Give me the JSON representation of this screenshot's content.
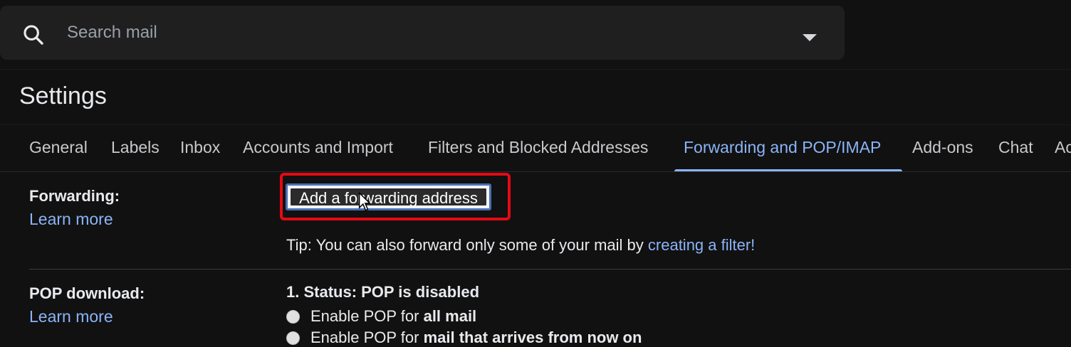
{
  "search": {
    "placeholder": "Search mail"
  },
  "page_title": "Settings",
  "tabs": [
    {
      "label": "General",
      "active": false
    },
    {
      "label": "Labels",
      "active": false
    },
    {
      "label": "Inbox",
      "active": false
    },
    {
      "label": "Accounts and Import",
      "active": false
    },
    {
      "label": "Filters and Blocked Addresses",
      "active": false
    },
    {
      "label": "Forwarding and POP/IMAP",
      "active": true
    },
    {
      "label": "Add-ons",
      "active": false
    },
    {
      "label": "Chat",
      "active": false
    },
    {
      "label": "Ac",
      "active": false
    }
  ],
  "forwarding": {
    "label": "Forwarding:",
    "learn_more": "Learn more",
    "button_label": "Add a forwarding address",
    "tip_prefix": "Tip: You can also forward only some of your mail by ",
    "tip_link": "creating a filter!"
  },
  "pop": {
    "label": "POP download:",
    "learn_more": "Learn more",
    "status": "1. Status: POP is disabled",
    "option1_prefix": "Enable POP for ",
    "option1_bold": "all mail",
    "option2_prefix": "Enable POP for ",
    "option2_bold": "mail that arrives from now on"
  },
  "colors": {
    "accent": "#8ab4f8",
    "highlight": "#e50914",
    "background": "#111111"
  },
  "icons": {
    "search": "search-icon",
    "dropdown": "search-options-icon",
    "cursor": "mouse-cursor-icon"
  }
}
